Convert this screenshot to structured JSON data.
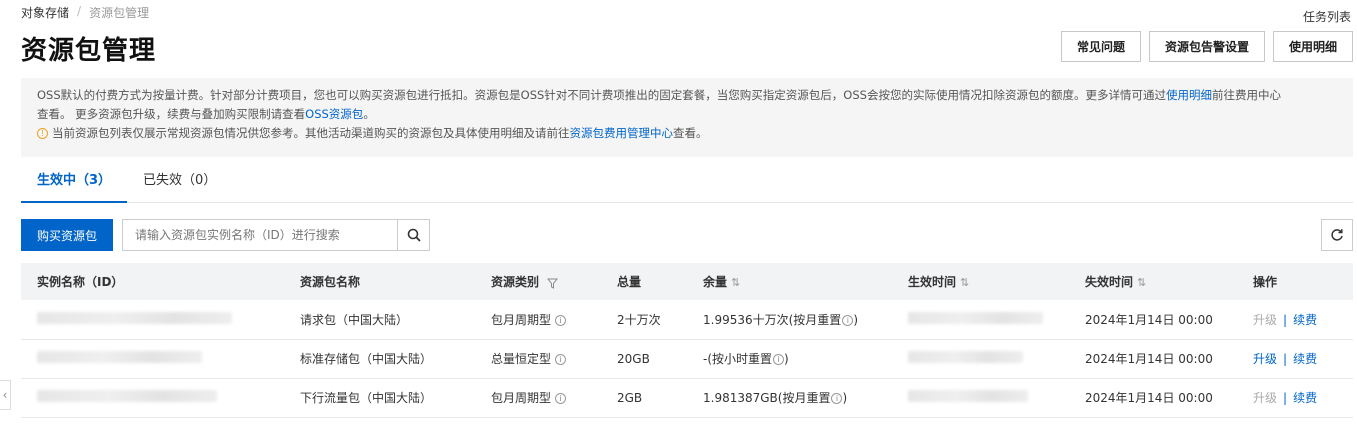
{
  "breadcrumb": {
    "root": "对象存储",
    "separator": "/",
    "current": "资源包管理"
  },
  "task_list": "任务列表",
  "title": "资源包管理",
  "header_buttons": {
    "faq": "常见问题",
    "alert_settings": "资源包告警设置",
    "usage_detail": "使用明细"
  },
  "notice": {
    "line1_a": "OSS默认的付费方式为按量计费。针对部分计费项目，您也可以购买资源包进行抵扣。资源包是OSS针对不同计费项推出的固定套餐，当您购买指定资源包后，OSS会按您的实际使用情况扣除资源包的额度。更多详情可通过",
    "line1_link": "使用明细",
    "line1_b": "前往费用中心",
    "line2_a": "查看。 更多资源包升级，续费与叠加购买限制请查看",
    "line2_link": "OSS资源包",
    "line2_b": "。",
    "tip_a": "当前资源包列表仅展示常规资源包情况供您参考。其他活动渠道购买的资源包及具体使用明细及请前往",
    "tip_link": "资源包费用管理中心",
    "tip_b": "查看。"
  },
  "tabs": [
    {
      "label": "生效中（3）",
      "active": true
    },
    {
      "label": "已失效（0）",
      "active": false
    }
  ],
  "toolbar": {
    "buy_label": "购买资源包",
    "search_placeholder": "请输入资源包实例名称（ID）进行搜索"
  },
  "table": {
    "headers": {
      "instance": "实例名称（ID）",
      "package_name": "资源包名称",
      "package_type": "资源类别",
      "total": "总量",
      "remaining": "余量",
      "effective_time": "生效时间",
      "expire_time": "失效时间",
      "actions": "操作"
    },
    "rows": [
      {
        "package_name": "请求包（中国大陆）",
        "package_type": "包月周期型",
        "total": "2十万次",
        "remaining": "1.99536十万次(按月重置",
        "expire_time": "2024年1月14日 00:00",
        "upgrade": "升级",
        "upgrade_enabled": false,
        "renew": "续费"
      },
      {
        "package_name": "标准存储包（中国大陆）",
        "package_type": "总量恒定型",
        "total": "20GB",
        "remaining": "-(按小时重置",
        "expire_time": "2024年1月14日 00:00",
        "upgrade": "升级",
        "upgrade_enabled": true,
        "renew": "续费"
      },
      {
        "package_name": "下行流量包（中国大陆）",
        "package_type": "包月周期型",
        "total": "2GB",
        "remaining": "1.981387GB(按月重置",
        "expire_time": "2024年1月14日 00:00",
        "upgrade": "升级",
        "upgrade_enabled": false,
        "renew": "续费"
      }
    ]
  },
  "remaining_suffix": ")",
  "colors": {
    "primary": "#0064c8",
    "notice_bg": "#f5f5f6",
    "header_bg": "#f2f3f5"
  }
}
